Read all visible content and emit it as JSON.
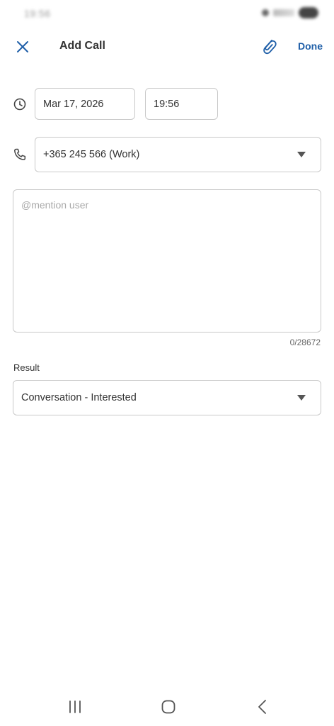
{
  "status_bar": {
    "time": "19:56"
  },
  "app_bar": {
    "title": "Add Call",
    "done_label": "Done",
    "close_icon": "close-icon",
    "attach_icon": "paperclip-icon"
  },
  "call": {
    "date": "Mar 17, 2026",
    "time": "19:56",
    "phone": "+365 245 566 (Work)"
  },
  "notes": {
    "placeholder": "@mention user",
    "char_count": "0/28672"
  },
  "result": {
    "label": "Result",
    "value": "Conversation - Interested"
  },
  "colors": {
    "accent": "#1f5fa8",
    "border": "#c9c9c9",
    "text": "#333333"
  }
}
